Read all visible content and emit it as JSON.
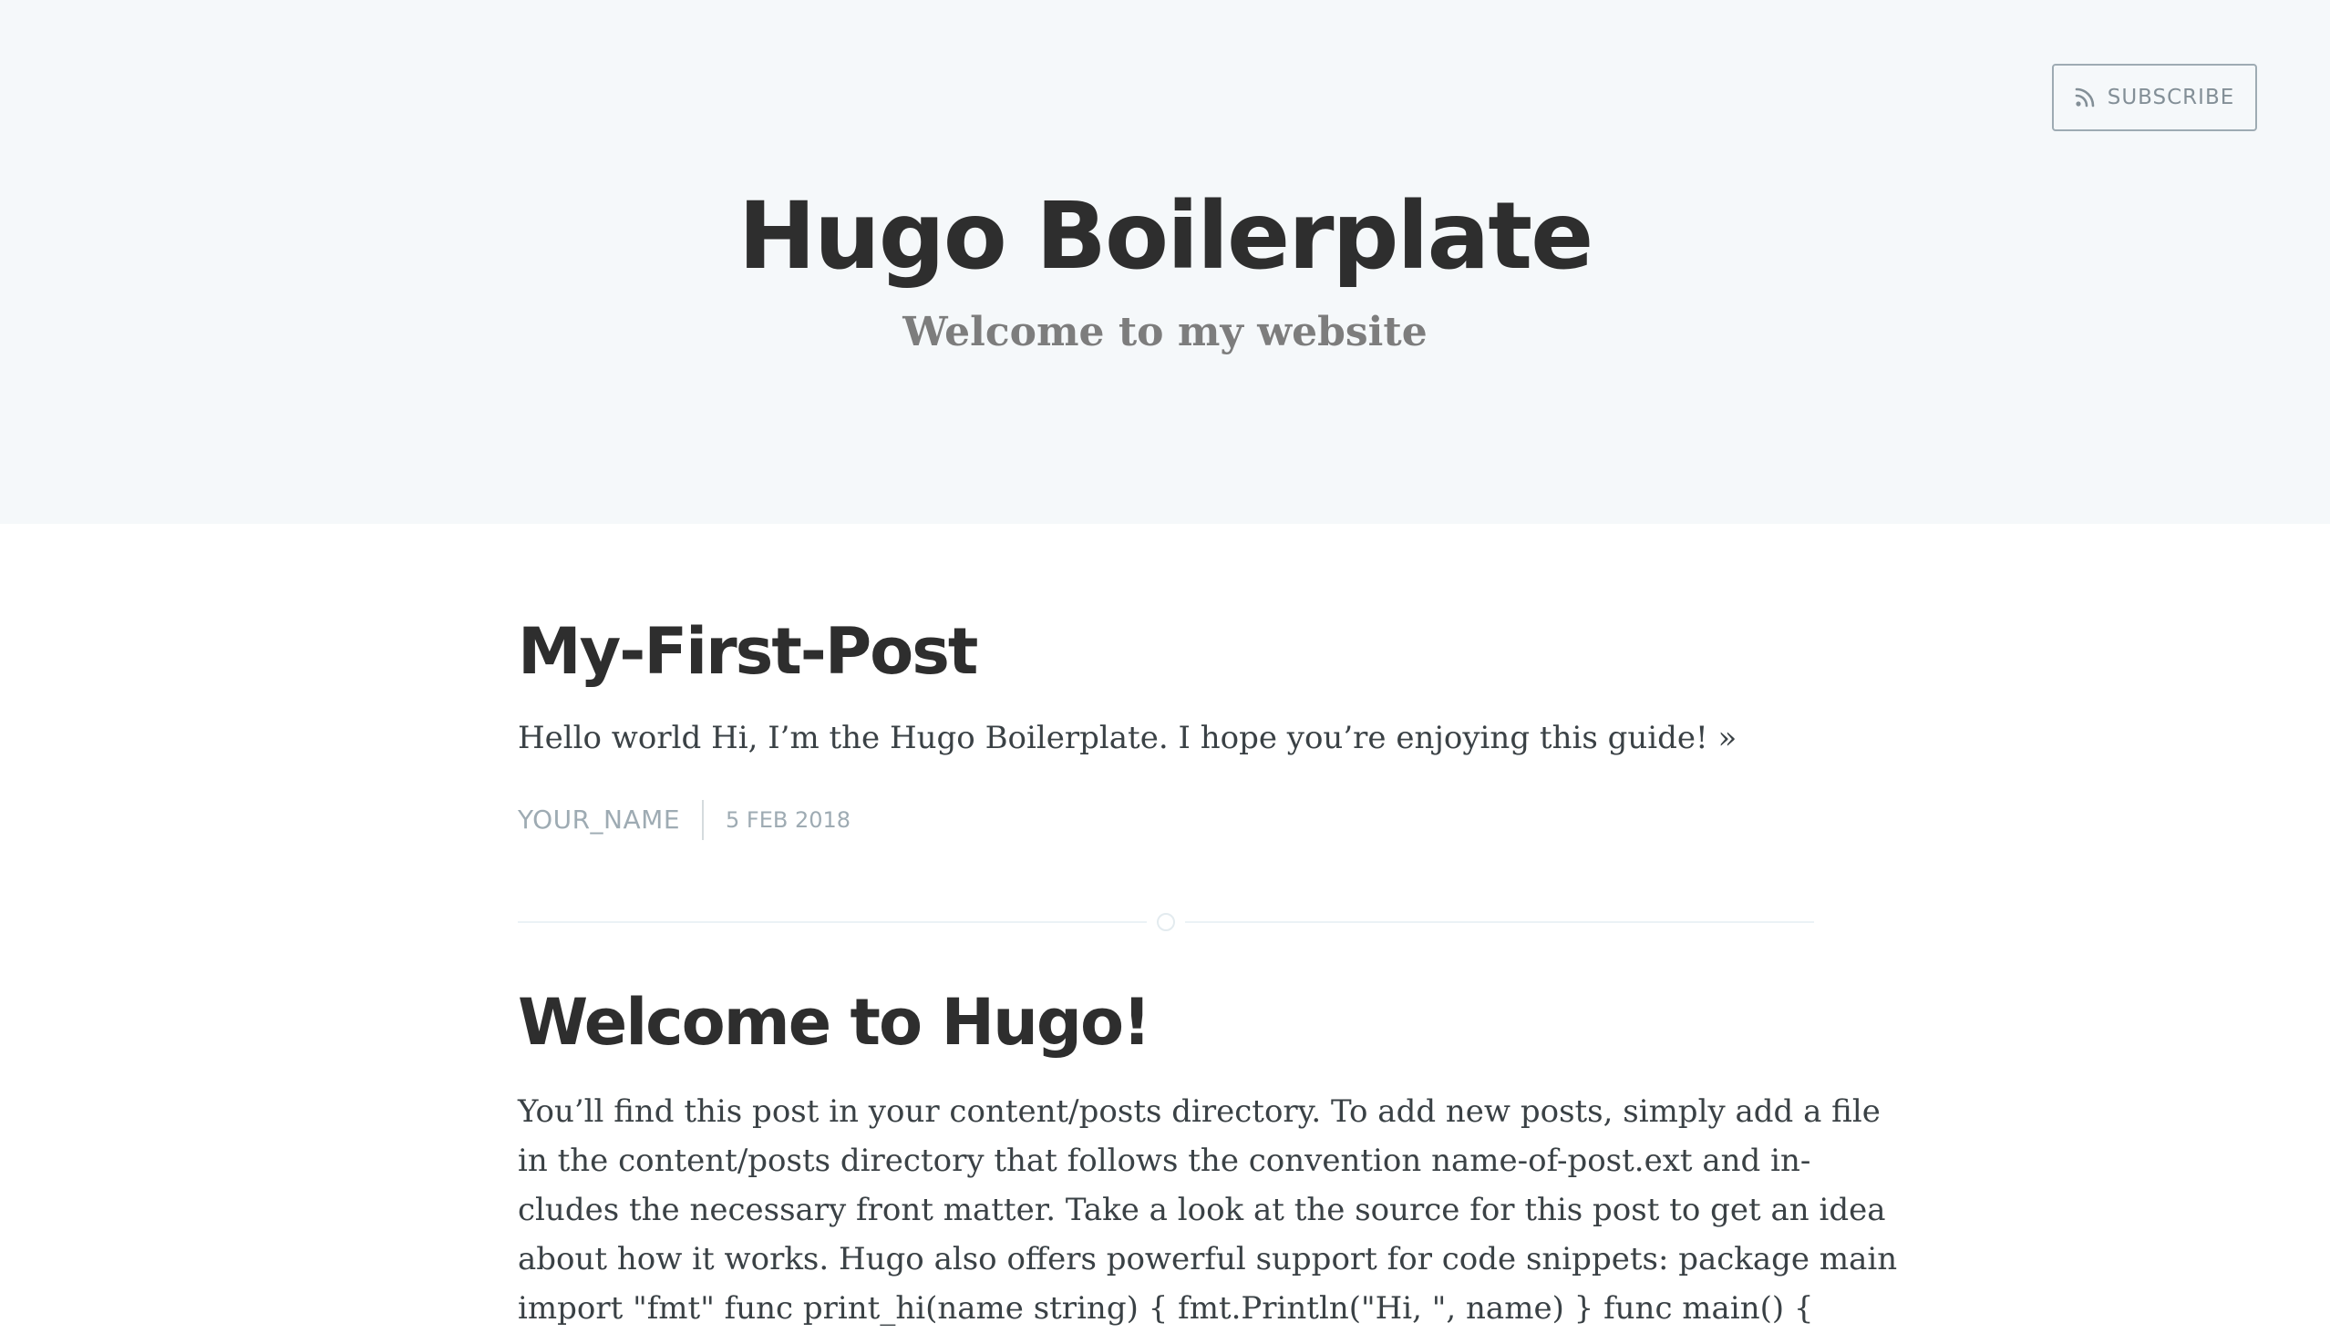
{
  "header": {
    "subscribe_label": "SUBSCRIBE",
    "subscribe_icon": "rss-icon",
    "blog_title": "Hugo Boilerplate",
    "blog_description": "Welcome to my website"
  },
  "posts": [
    {
      "title": "My-First-Post",
      "excerpt": "Hello world Hi, I’m the Hugo Boilerplate. I hope you’re enjoying this guide!",
      "read_more": "»",
      "author": "YOUR_NAME",
      "date": "5 FEB 2018"
    },
    {
      "title": "Welcome to Hugo!",
      "body_lines": [
        "You’ll find this post in your content/posts directory. To add new posts, simply add a file",
        "in the content/posts directory that follows the convention name-of-post.ext and in-",
        "cludes the necessary front matter. Take a look at the source for this post to get an idea",
        "about how it works. Hugo also offers powerful support for code snippets: package main",
        "import \"fmt\" func print_hi(name string) { fmt.Println(\"Hi, \", name) } func main() {"
      ]
    }
  ],
  "colors": {
    "header_bg": "#f5f8fa",
    "title": "#2e2e2e",
    "text": "#3a4145",
    "meta": "#9eabb3",
    "divider": "#ebf2f6"
  }
}
